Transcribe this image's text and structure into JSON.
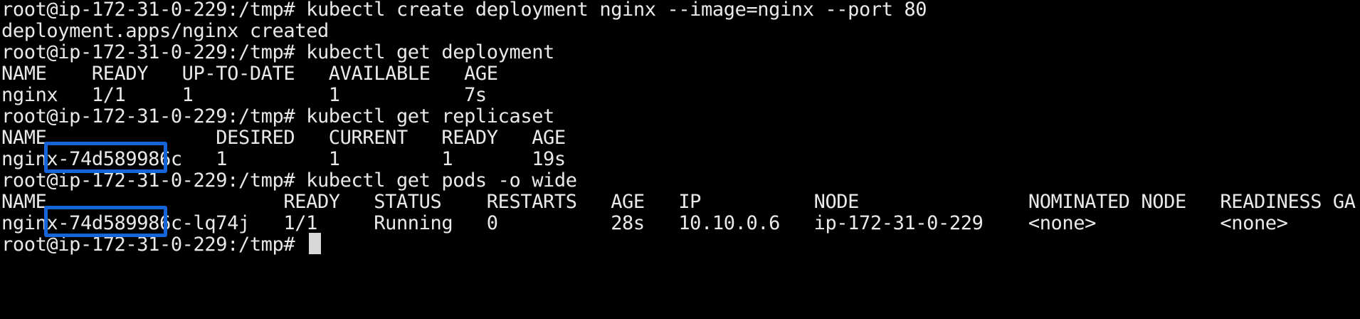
{
  "terminal": {
    "lines": [
      "root@ip-172-31-0-229:/tmp# kubectl create deployment nginx --image=nginx --port 80",
      "deployment.apps/nginx created",
      "root@ip-172-31-0-229:/tmp# kubectl get deployment",
      "NAME    READY   UP-TO-DATE   AVAILABLE   AGE",
      "nginx   1/1     1            1           7s",
      "root@ip-172-31-0-229:/tmp# kubectl get replicaset",
      "NAME               DESIRED   CURRENT   READY   AGE",
      "nginx-74d589986c   1         1         1       19s",
      "root@ip-172-31-0-229:/tmp# kubectl get pods -o wide",
      "NAME                     READY   STATUS    RESTARTS   AGE   IP          NODE               NOMINATED NODE   READINESS GA",
      "nginx-74d589986c-lq74j   1/1     Running   0          28s   10.10.0.6   ip-172-31-0-229    <none>           <none>",
      "root@ip-172-31-0-229:/tmp# "
    ]
  },
  "colors": {
    "background": "#000000",
    "text": "#e9e9e9",
    "highlight": "#1565d8"
  }
}
